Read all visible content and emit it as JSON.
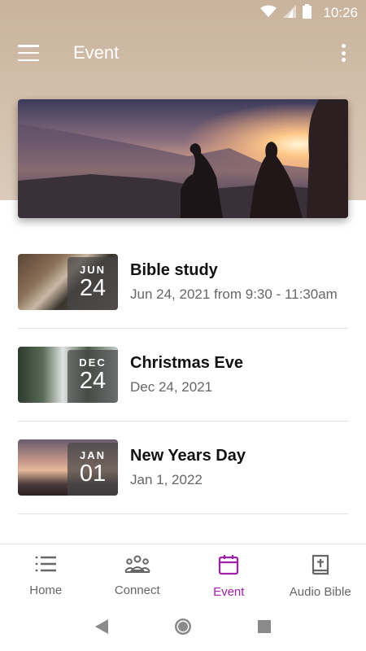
{
  "status_bar": {
    "time": "10:26"
  },
  "app_bar": {
    "title": "Event"
  },
  "events": [
    {
      "title": "Bible study",
      "date_text": "Jun 24, 2021 from 9:30 - 11:30am",
      "month": "JUN",
      "day": "24"
    },
    {
      "title": "Christmas Eve",
      "date_text": "Dec 24, 2021",
      "month": "DEC",
      "day": "24"
    },
    {
      "title": "New Years Day",
      "date_text": "Jan 1, 2022",
      "month": "JAN",
      "day": "01"
    }
  ],
  "bottom_nav": {
    "items": [
      {
        "label": "Home",
        "icon": "list-icon"
      },
      {
        "label": "Connect",
        "icon": "group-icon"
      },
      {
        "label": "Event",
        "icon": "calendar-icon",
        "active": true
      },
      {
        "label": "Audio Bible",
        "icon": "bible-icon"
      }
    ]
  },
  "colors": {
    "accent": "#a020a8",
    "header_bg": "#d3c0ad"
  }
}
